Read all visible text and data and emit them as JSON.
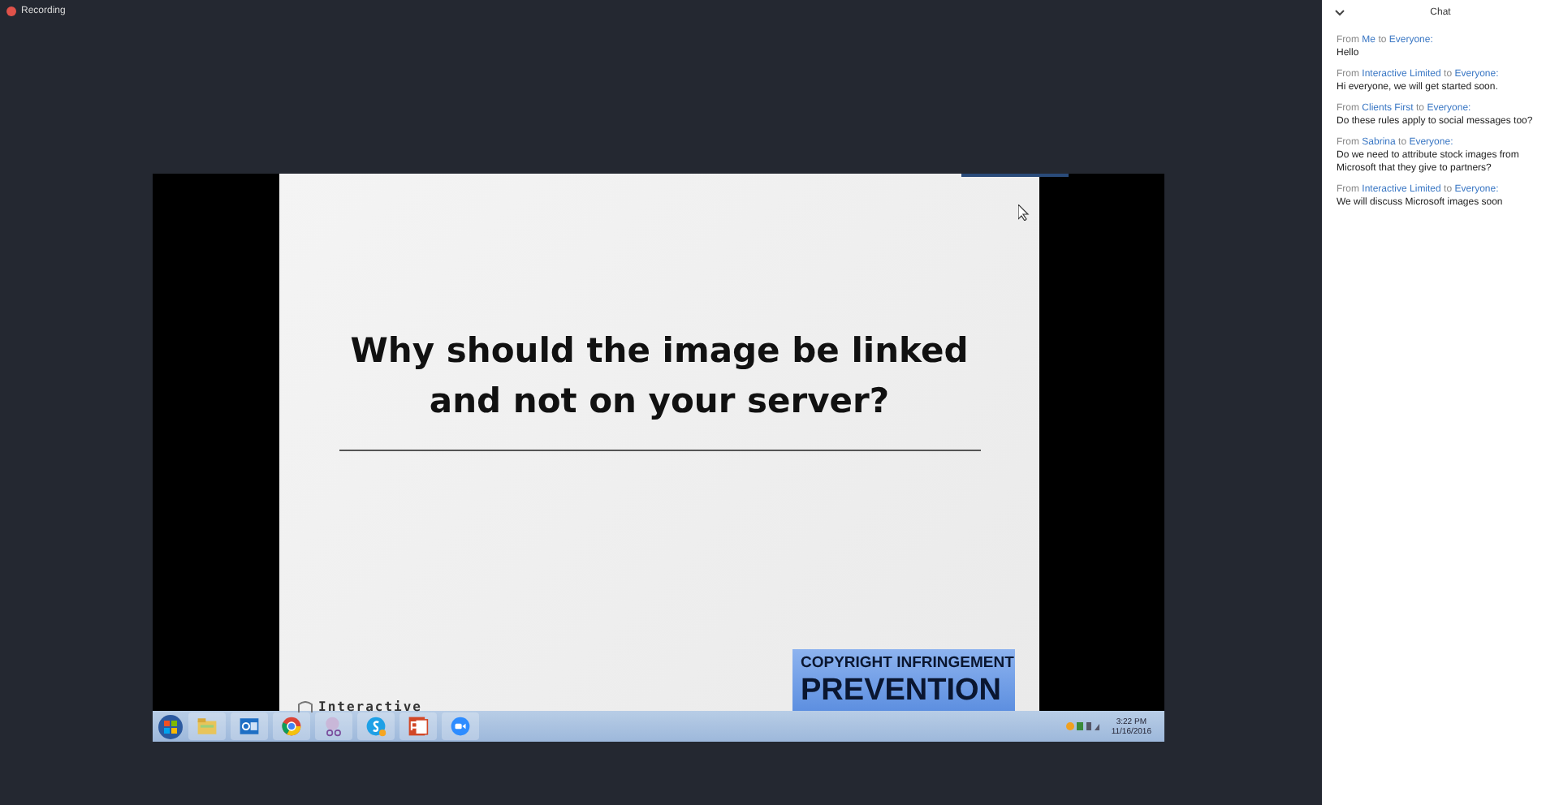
{
  "recording": {
    "label": "Recording"
  },
  "slide": {
    "title": "Why should the image be linked and not on your server?",
    "logo_text": "Interactive",
    "banner": {
      "line_1": "COPYRIGHT INFRINGEMENT",
      "line_2": "PREVENTION"
    }
  },
  "taskbar": {
    "apps": [
      {
        "kind": "folder"
      },
      {
        "kind": "mail"
      },
      {
        "kind": "browser"
      },
      {
        "kind": "tool"
      },
      {
        "kind": "chat"
      },
      {
        "kind": "slides"
      },
      {
        "kind": "video"
      }
    ],
    "time": "3:22 PM",
    "date": "11/16/2016"
  },
  "chat": {
    "title": "Chat",
    "messages": [
      {
        "from_label": "From",
        "sender": "Me",
        "to_label": "to",
        "recipient": "Everyone:",
        "text": "Hello"
      },
      {
        "from_label": "From",
        "sender": "Interactive Limited",
        "to_label": "to",
        "recipient": "Everyone:",
        "text": "Hi everyone, we will get started soon."
      },
      {
        "from_label": "From",
        "sender": "Clients First",
        "to_label": "to",
        "recipient": "Everyone:",
        "text": "Do these rules apply to social messages too?"
      },
      {
        "from_label": "From",
        "sender": "Sabrina",
        "to_label": "to",
        "recipient": "Everyone:",
        "text": "Do we need to attribute stock images from Microsoft that they give to partners?"
      },
      {
        "from_label": "From",
        "sender": "Interactive Limited",
        "to_label": "to",
        "recipient": "Everyone:",
        "text": "We will discuss Microsoft images soon"
      }
    ]
  }
}
